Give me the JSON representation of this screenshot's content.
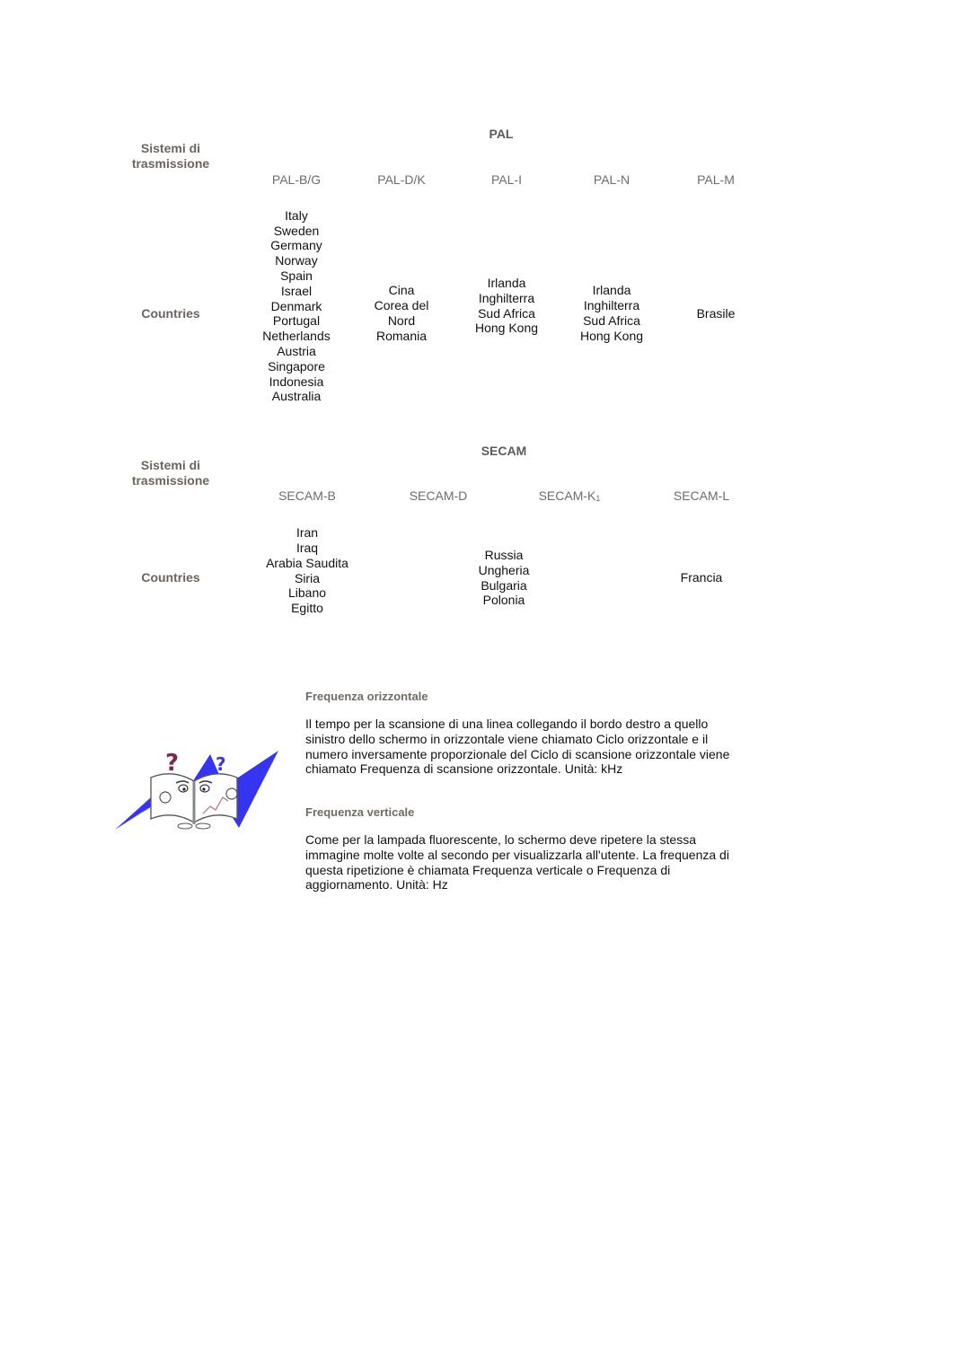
{
  "pal_table": {
    "row_label_systems": "Sistemi di trasmissione",
    "group_title": "PAL",
    "systems": [
      "PAL-B/G",
      "PAL-D/K",
      "PAL-I",
      "PAL-N",
      "PAL-M"
    ],
    "row_label_countries": "Countries",
    "countries": [
      [
        "Italy",
        "Sweden",
        "Germany",
        "Norway",
        "Spain",
        "Israel",
        "Denmark",
        "Portugal",
        "Netherlands",
        "Austria",
        "Singapore",
        "Indonesia",
        "Australia"
      ],
      [
        "Cina",
        "Corea del",
        "Nord",
        "Romania"
      ],
      [
        "Irlanda",
        "Inghilterra",
        "Sud Africa",
        "Hong Kong"
      ],
      [
        "Irlanda",
        "Inghilterra",
        "Sud Africa",
        "Hong Kong"
      ],
      [
        "Brasile"
      ]
    ]
  },
  "secam_table": {
    "row_label_systems": "Sistemi di trasmissione",
    "group_title": "SECAM",
    "systems": [
      "SECAM-B",
      "SECAM-D",
      "SECAM-K",
      "SECAM-L"
    ],
    "system_subscripts": [
      "",
      "",
      "1",
      ""
    ],
    "row_label_countries": "Countries",
    "countries": [
      [
        "Iran",
        "Iraq",
        "Arabia Saudita",
        "Siria",
        "Libano",
        "Egitto"
      ],
      [
        "Russia",
        "Ungheria",
        "Bulgaria",
        "Polonia"
      ],
      [
        "Francia"
      ]
    ]
  },
  "glossary": {
    "illustration": "book-question-mark-icon",
    "colors": {
      "zigzag": "#2a2af0",
      "question_mark_1": "#7a2a55",
      "question_mark_2": "#3a3ad0"
    },
    "sections": [
      {
        "title": "Frequenza orizzontale",
        "lines": [
          "Il tempo per la scansione di una linea collegando il bordo destro a quello",
          "sinistro dello schermo in orizzontale viene chiamato Ciclo orizzontale e il",
          "numero inversamente proporzionale del Ciclo di scansione orizzontale viene",
          "chiamato Frequenza di scansione orizzontale. Unità: kHz"
        ]
      },
      {
        "title": "Frequenza verticale",
        "lines": [
          "Come per la lampada fluorescente, lo schermo deve ripetere la stessa",
          "immagine molte volte al secondo per visualizzarla all'utente. La frequenza di",
          "questa ripetizione è chiamata Frequenza verticale o Frequenza di",
          "aggiornamento. Unità: Hz"
        ]
      }
    ]
  }
}
